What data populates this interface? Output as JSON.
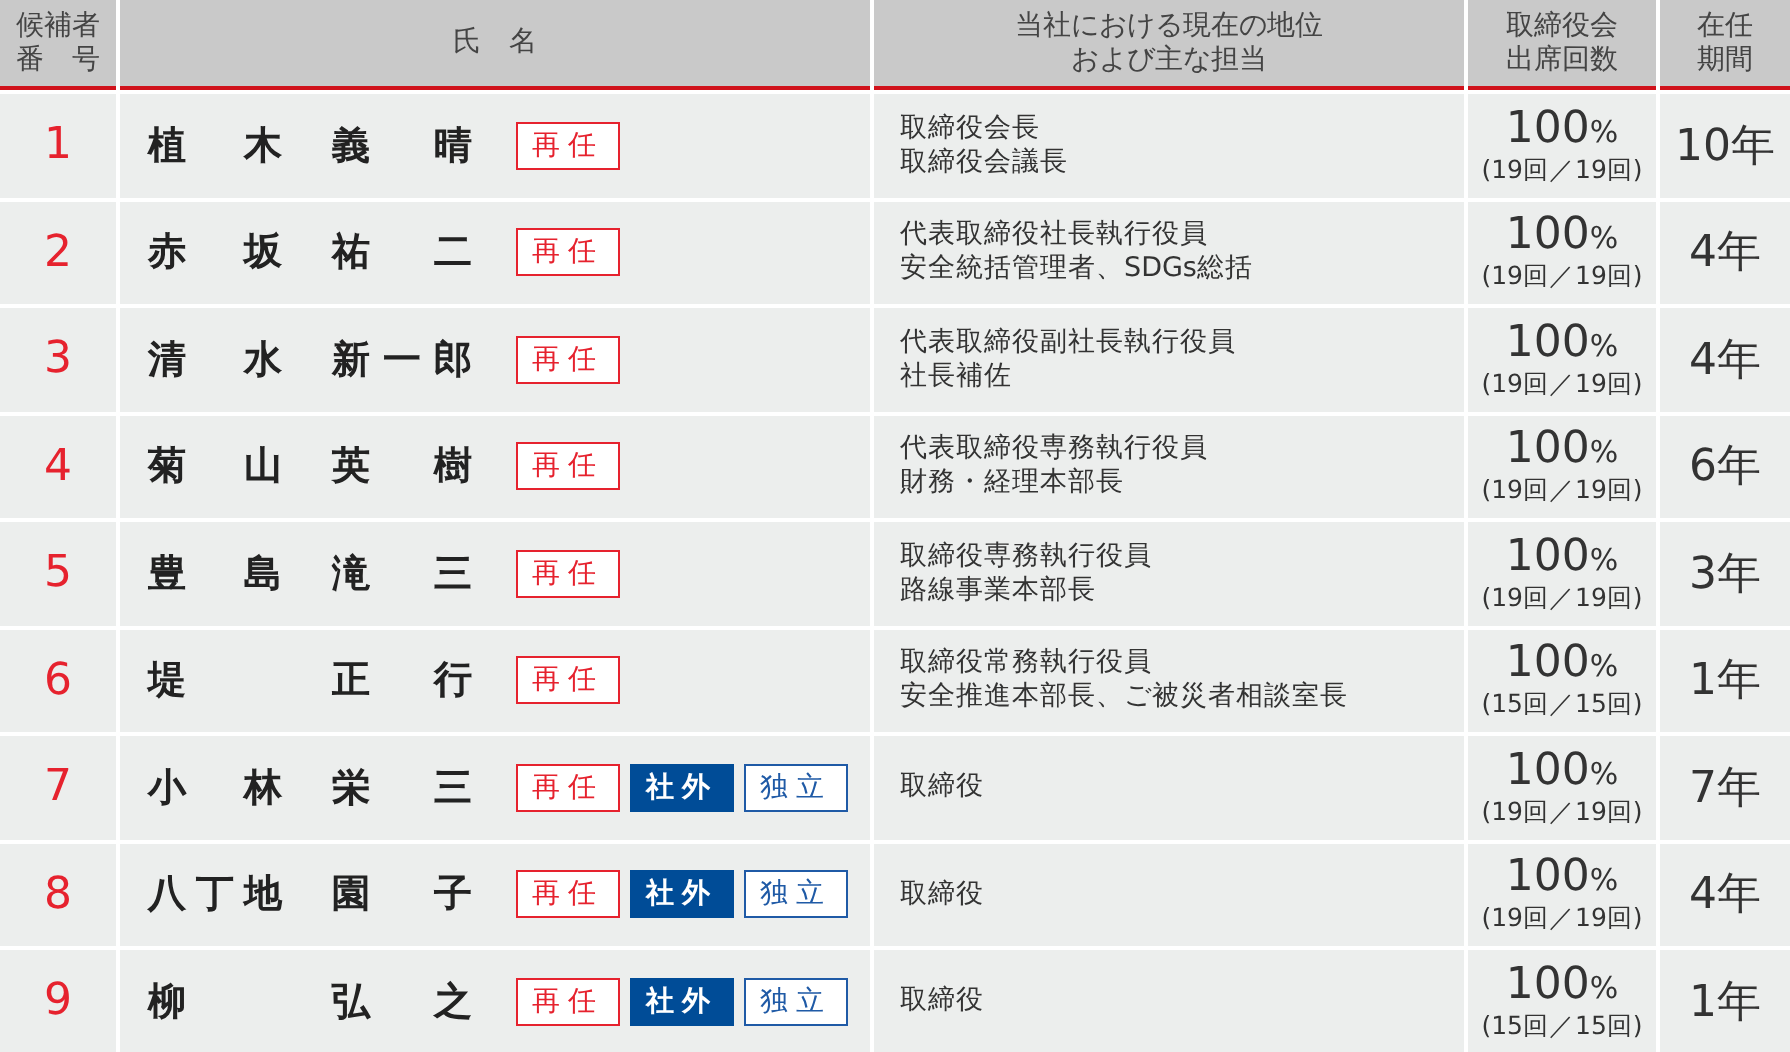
{
  "header": {
    "number": [
      "候補者",
      "番　号"
    ],
    "name": "氏　名",
    "position": [
      "当社における現在の地位",
      "および主な担当"
    ],
    "attendance": [
      "取締役会",
      "出席回数"
    ],
    "tenure": [
      "在任",
      "期間"
    ]
  },
  "rows": [
    {
      "number": "1",
      "family": "植木",
      "given": "義晴",
      "tags": [
        {
          "kind": "reappointed",
          "label": "再任"
        }
      ],
      "position": [
        "取締役会長",
        "取締役会議長"
      ],
      "rate": "100",
      "unit": "%",
      "meetings": "(19回／19回)",
      "tenure": "10年"
    },
    {
      "number": "2",
      "family": "赤坂",
      "given": "祐二",
      "tags": [
        {
          "kind": "reappointed",
          "label": "再任"
        }
      ],
      "position": [
        "代表取締役社長執行役員",
        "安全統括管理者、SDGs総括"
      ],
      "rate": "100",
      "unit": "%",
      "meetings": "(19回／19回)",
      "tenure": "4年"
    },
    {
      "number": "3",
      "family": "清水",
      "given": "新一郎",
      "tags": [
        {
          "kind": "reappointed",
          "label": "再任"
        }
      ],
      "position": [
        "代表取締役副社長執行役員",
        "社長補佐"
      ],
      "rate": "100",
      "unit": "%",
      "meetings": "(19回／19回)",
      "tenure": "4年"
    },
    {
      "number": "4",
      "family": "菊山",
      "given": "英樹",
      "tags": [
        {
          "kind": "reappointed",
          "label": "再任"
        }
      ],
      "position": [
        "代表取締役専務執行役員",
        "財務・経理本部長"
      ],
      "rate": "100",
      "unit": "%",
      "meetings": "(19回／19回)",
      "tenure": "6年"
    },
    {
      "number": "5",
      "family": "豊島",
      "given": "滝三",
      "tags": [
        {
          "kind": "reappointed",
          "label": "再任"
        }
      ],
      "position": [
        "取締役専務執行役員",
        "路線事業本部長"
      ],
      "rate": "100",
      "unit": "%",
      "meetings": "(19回／19回)",
      "tenure": "3年"
    },
    {
      "number": "6",
      "family": "堤",
      "given": "正行",
      "tags": [
        {
          "kind": "reappointed",
          "label": "再任"
        }
      ],
      "position": [
        "取締役常務執行役員",
        "安全推進本部長、ご被災者相談室長"
      ],
      "rate": "100",
      "unit": "%",
      "meetings": "(15回／15回)",
      "tenure": "1年"
    },
    {
      "number": "7",
      "family": "小林",
      "given": "栄三",
      "tags": [
        {
          "kind": "reappointed",
          "label": "再任"
        },
        {
          "kind": "outside",
          "label": "社外"
        },
        {
          "kind": "independent",
          "label": "独立"
        }
      ],
      "position": [
        "取締役"
      ],
      "rate": "100",
      "unit": "%",
      "meetings": "(19回／19回)",
      "tenure": "7年"
    },
    {
      "number": "8",
      "family": "八丁地",
      "given": "園子",
      "tags": [
        {
          "kind": "reappointed",
          "label": "再任"
        },
        {
          "kind": "outside",
          "label": "社外"
        },
        {
          "kind": "independent",
          "label": "独立"
        }
      ],
      "position": [
        "取締役"
      ],
      "rate": "100",
      "unit": "%",
      "meetings": "(19回／19回)",
      "tenure": "4年"
    },
    {
      "number": "9",
      "family": "柳",
      "given": "弘之",
      "tags": [
        {
          "kind": "reappointed",
          "label": "再任"
        },
        {
          "kind": "outside",
          "label": "社外"
        },
        {
          "kind": "independent",
          "label": "独立"
        }
      ],
      "position": [
        "取締役"
      ],
      "rate": "100",
      "unit": "%",
      "meetings": "(15回／15回)",
      "tenure": "1年"
    }
  ]
}
